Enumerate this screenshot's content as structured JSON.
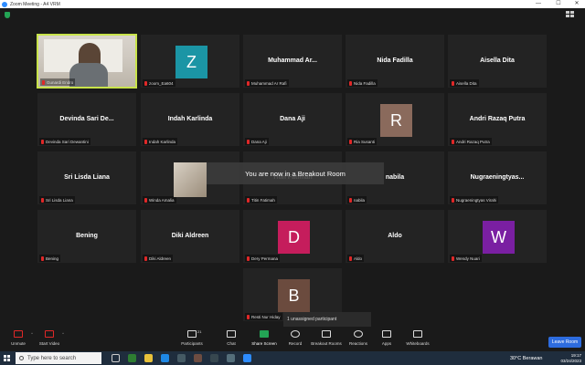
{
  "window": {
    "title": "Zoom Meeting - A4 VRM",
    "minimize": "—",
    "maximize": "☐",
    "close": "✕"
  },
  "participants": [
    {
      "display": "",
      "label": "Gunardi Endro",
      "video": true,
      "active": true
    },
    {
      "display": "Z",
      "label": "zoom_Ea604",
      "avatar_color": "#1b95a5"
    },
    {
      "display": "Muhammad  Ar...",
      "label": "Muhammad Ar Rafi"
    },
    {
      "display": "Nida Fadilla",
      "label": "Nida Fadilla"
    },
    {
      "display": "Aisella Dita",
      "label": "Aisella Dita"
    },
    {
      "display": "Devinda  Sari  De...",
      "label": "Devinda Sari Dewantini"
    },
    {
      "display": "Indah Karlinda",
      "label": "Indah Karlinda"
    },
    {
      "display": "Dana Aji",
      "label": "Dana Aji"
    },
    {
      "display": "R",
      "label": "Ria Susanti",
      "avatar_color": "#8a6a5c"
    },
    {
      "display": "Andri Razaq Putra",
      "label": "Andri Razaq Putra"
    },
    {
      "display": "Sri Lisda Liana",
      "label": "Sri Lisda Liana"
    },
    {
      "display": "",
      "label": "Winda Amalia"
    },
    {
      "display": "Titin Fatimah",
      "label": "Titin Fatimah"
    },
    {
      "display": "nabila",
      "label": "nabila"
    },
    {
      "display": "Nugraeningtyas...",
      "label": "Nugraeningtyas Virahi"
    },
    {
      "display": "Bening",
      "label": "Bening"
    },
    {
      "display": "Diki Aldreen",
      "label": "Diki Aldreen"
    },
    {
      "display": "D",
      "label": "Dery Permana",
      "avatar_color": "#c51d5c"
    },
    {
      "display": "Aldo",
      "label": "Aldo"
    },
    {
      "display": "W",
      "label": "Wendy Nuari",
      "avatar_color": "#7a1fa2"
    },
    {
      "display": "B",
      "label": "Resti Nur Hiday",
      "avatar_color": "#6b4b3e"
    }
  ],
  "notifications": {
    "breakout": "You are now in a Breakout Room",
    "unassigned": "1 unassigned participant"
  },
  "toolbar": {
    "unmute": "Unmute",
    "start_video": "Start Video",
    "participants": "Participants",
    "participants_count": "21",
    "chat": "Chat",
    "share_screen": "Share Screen",
    "record": "Record",
    "breakout_rooms": "Breakout Rooms",
    "reactions": "Reactions",
    "apps": "Apps",
    "whiteboards": "Whiteboards",
    "leave": "Leave Room"
  },
  "taskbar": {
    "search_placeholder": "Type here to search",
    "weather": "30°C  Berawan",
    "time": "19:17",
    "date": "03/24/2023"
  }
}
